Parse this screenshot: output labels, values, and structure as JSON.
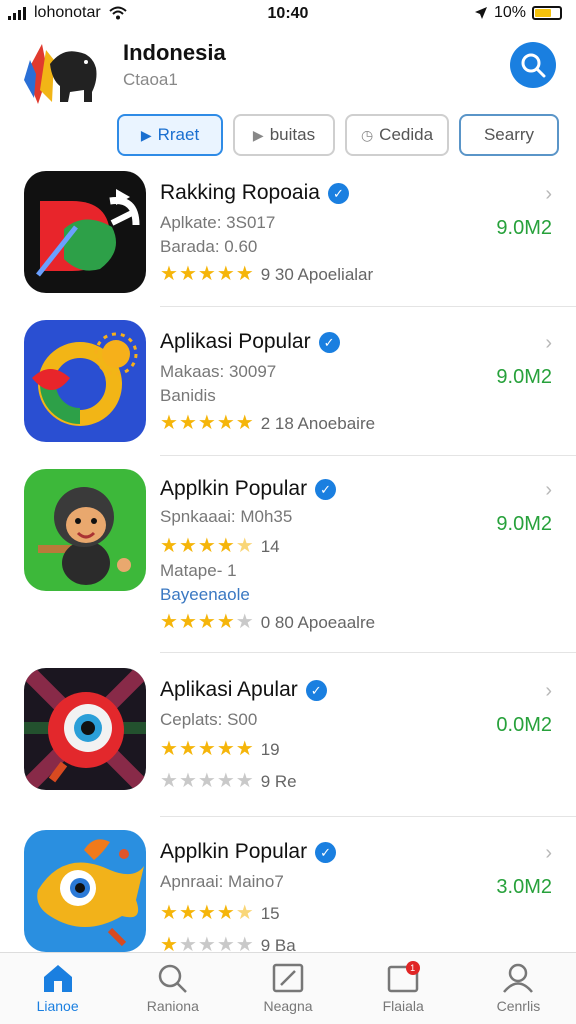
{
  "status_bar": {
    "carrier": "lohonotar",
    "time": "10:40",
    "battery": "10%",
    "battery_level": 0.65
  },
  "header": {
    "title": "Indonesia",
    "subtitle": "Ctaoa1"
  },
  "chips": [
    {
      "label": "Rraet",
      "icon": "play-icon"
    },
    {
      "label": "buitas",
      "icon": "play-icon"
    },
    {
      "label": "Cedida",
      "icon": "clock-icon"
    },
    {
      "label": "Searry",
      "icon": ""
    }
  ],
  "apps": [
    {
      "name": "Rakking Ropoaia",
      "meta1": "Aplkate: 3S017",
      "meta2": "Barada: 0.60",
      "rating_stars": 5,
      "rating_text": "9 30 Apoelialar",
      "size": "9.0M2"
    },
    {
      "name": "Aplikasi Popular",
      "meta1": "Makaas: 30097",
      "meta2": "Banidis",
      "rating_stars": 5,
      "rating_text": "2 18 Anoebaire",
      "size": "9.0M2"
    },
    {
      "name": "Applkin Popular",
      "meta1": "Spnkaaai: M0h35",
      "rating1_stars": 4.5,
      "rating1_text": "14",
      "meta2": "Matape- 1",
      "meta3": "Bayeenaole",
      "rating2_stars": 4,
      "rating2_text": "0 80 Apoeaalre",
      "size": "9.0M2"
    },
    {
      "name": "Aplikasi Apular",
      "meta1": "Ceplats: S00",
      "rating1_stars": 5,
      "rating1_text": "19",
      "rating2_stars": 0,
      "rating2_text": "9 Re",
      "size": "0.0M2"
    },
    {
      "name": "Applkin Popular",
      "meta1": "Apnraai: Maino7",
      "rating1_stars": 4.5,
      "rating1_text": "15",
      "rating2_stars": 1,
      "rating2_text": "9 Ba",
      "size": "3.0M2"
    }
  ],
  "tabs": [
    {
      "label": "Lianoe",
      "icon": "home-icon"
    },
    {
      "label": "Raniona",
      "icon": "search-icon"
    },
    {
      "label": "Neagna",
      "icon": "edit-icon"
    },
    {
      "label": "Flaiala",
      "icon": "notification-icon",
      "badge": "1"
    },
    {
      "label": "Cenrlis",
      "icon": "profile-icon"
    }
  ],
  "colors": {
    "accent": "#1a7fe0",
    "size_green": "#27a13b",
    "star": "#f5b50a",
    "badge_red": "#e02525"
  }
}
